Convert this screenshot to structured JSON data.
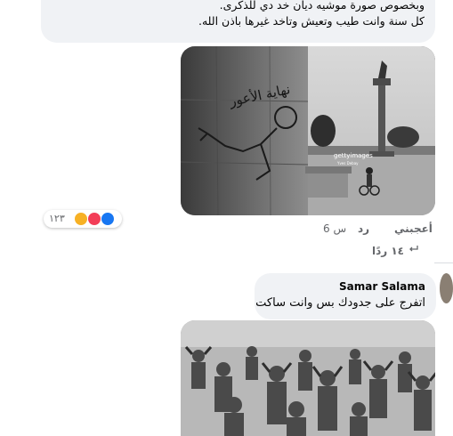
{
  "comment1": {
    "line1": "وبخصوص صورة موشيه ديان خد دي للذكرى.",
    "line2": "كل سنة وانت طيب وتعيش وتاخد غيرها باذن الله."
  },
  "photo1": {
    "wall_text": "نهاية الأعور",
    "watermark": "gettyimages",
    "watermark_sub": "Yves Debay"
  },
  "reactions": {
    "count": "١٢٣",
    "types": [
      "like",
      "love",
      "haha"
    ],
    "colors": {
      "like": "#1877f2",
      "love": "#f33e58",
      "haha": "#f7b125"
    }
  },
  "actions": {
    "like": "أعجبني",
    "reply": "رد",
    "time": "6 س"
  },
  "replies": {
    "label": "١٤ ردًا"
  },
  "comment2": {
    "author": "Samar Salama",
    "text": "اتفرج على جدودك بس وانت ساكت"
  }
}
